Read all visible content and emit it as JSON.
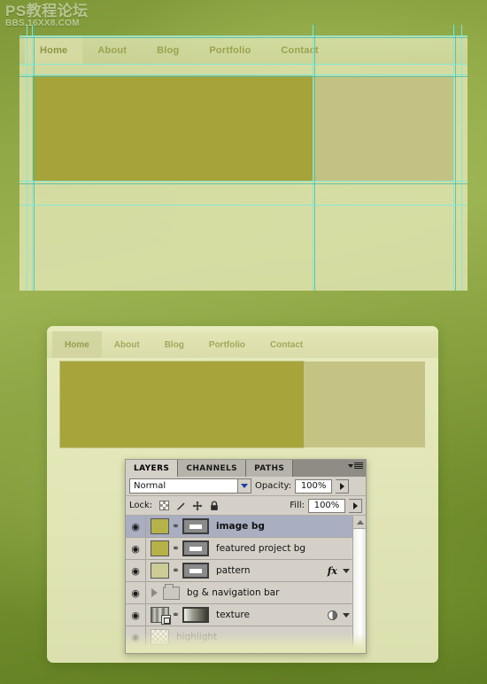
{
  "watermark": {
    "main": "PS教程论坛",
    "sub": "BBS.16XX8.COM"
  },
  "mockup_top": {
    "nav": [
      {
        "label": "Home",
        "active": true
      },
      {
        "label": "About",
        "active": false
      },
      {
        "label": "Blog",
        "active": false
      },
      {
        "label": "Portfolio",
        "active": false
      },
      {
        "label": "Contact",
        "active": false
      }
    ],
    "blocks": {
      "image_bg_color": "#a6a33a",
      "featured_bg_color": "#c4c283",
      "page_bg_color": "#e4e7b8"
    },
    "guide_color": "#7fe8d8"
  },
  "mockup_bottom": {
    "nav": [
      {
        "label": "Home",
        "active": true
      },
      {
        "label": "About",
        "active": false
      },
      {
        "label": "Blog",
        "active": false
      },
      {
        "label": "Portfolio",
        "active": false
      },
      {
        "label": "Contact",
        "active": false
      }
    ],
    "blocks": {
      "image_bg_color": "#a7a43b",
      "featured_bg_color": "#c5c384"
    }
  },
  "layers_panel": {
    "tabs": [
      {
        "label": "LAYERS",
        "active": true
      },
      {
        "label": "CHANNELS",
        "active": false
      },
      {
        "label": "PATHS",
        "active": false
      }
    ],
    "menu_icon": "panel-menu-icon",
    "blend_mode": "Normal",
    "opacity_label": "Opacity:",
    "opacity_value": "100%",
    "lock_label": "Lock:",
    "lock_icons": [
      "lock-transparency-icon",
      "lock-image-icon",
      "lock-position-icon",
      "lock-all-icon"
    ],
    "fill_label": "Fill:",
    "fill_value": "100%",
    "layers": [
      {
        "name": "image bg",
        "visible": true,
        "selected": true,
        "type": "layer",
        "thumb": "t-imgbg",
        "mask": "solid",
        "linked": true,
        "fx": false,
        "adjust": false,
        "dim": false
      },
      {
        "name": "featured project bg",
        "visible": true,
        "selected": false,
        "type": "layer",
        "thumb": "t-feat",
        "mask": "solid",
        "linked": true,
        "fx": false,
        "adjust": false,
        "dim": false
      },
      {
        "name": "pattern",
        "visible": true,
        "selected": false,
        "type": "layer",
        "thumb": "t-pat",
        "mask": "solid",
        "linked": true,
        "fx": true,
        "adjust": false,
        "dim": false
      },
      {
        "name": "bg & navigation bar",
        "visible": true,
        "selected": false,
        "type": "group",
        "thumb": "",
        "mask": "",
        "linked": false,
        "fx": false,
        "adjust": false,
        "dim": false
      },
      {
        "name": "texture",
        "visible": true,
        "selected": false,
        "type": "smart",
        "thumb": "t-tex",
        "mask": "grad",
        "linked": true,
        "fx": false,
        "adjust": true,
        "dim": false
      },
      {
        "name": "highlight",
        "visible": false,
        "selected": false,
        "type": "layer",
        "thumb": "t-high",
        "mask": "",
        "linked": false,
        "fx": false,
        "adjust": false,
        "dim": true
      }
    ],
    "eye_glyph": "◉",
    "link_glyph": "⚭",
    "fx_glyph": "fx",
    "scrollbar": "vertical-scrollbar"
  }
}
